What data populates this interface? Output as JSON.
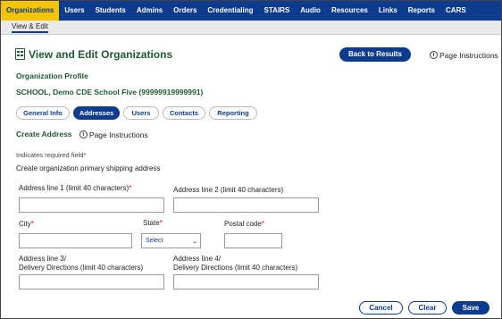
{
  "topnav": {
    "items": [
      "Organizations",
      "Users",
      "Students",
      "Admins",
      "Orders",
      "Credentialing",
      "STAIRS",
      "Audio",
      "Resources",
      "Links",
      "Reports",
      "CARS"
    ],
    "active_index": 0
  },
  "subnav": {
    "item": "View & Edit"
  },
  "header": {
    "title": "View and Edit Organizations",
    "back_button": "Back to Results",
    "page_instructions": "Page Instructions"
  },
  "org": {
    "profile_label": "Organization Profile",
    "name": "SCHOOL, Demo CDE School Five (99999919999991)"
  },
  "tabs": [
    {
      "label": "General Info",
      "active": false
    },
    {
      "label": "Addresses",
      "active": true
    },
    {
      "label": "Users",
      "active": false
    },
    {
      "label": "Contacts",
      "active": false
    },
    {
      "label": "Reporting",
      "active": false
    }
  ],
  "section": {
    "title": "Create Address",
    "page_instructions": "Page Instructions"
  },
  "form": {
    "required_note": "Indicates required field",
    "description": "Create organization primary shipping address",
    "address1_label": "Address line 1 (limit 40 characters)",
    "address2_label": "Address line 2 (limit 40 characters)",
    "city_label": "City",
    "state_label": "State",
    "state_value": "Select",
    "postal_label": "Postal code",
    "address3_label_line1": "Address line 3/",
    "address3_label_line2": "Delivery Directions (limit 40 characters)",
    "address4_label_line1": "Address line 4/",
    "address4_label_line2": "Delivery Directions (limit 40 characters)"
  },
  "footer": {
    "cancel": "Cancel",
    "clear": "Clear",
    "save": "Save"
  },
  "colors": {
    "nav_bg": "#0d3b8e",
    "nav_active_bg": "#f5c400",
    "heading_green": "#1f5a2e",
    "required_star": "#cc0000"
  }
}
